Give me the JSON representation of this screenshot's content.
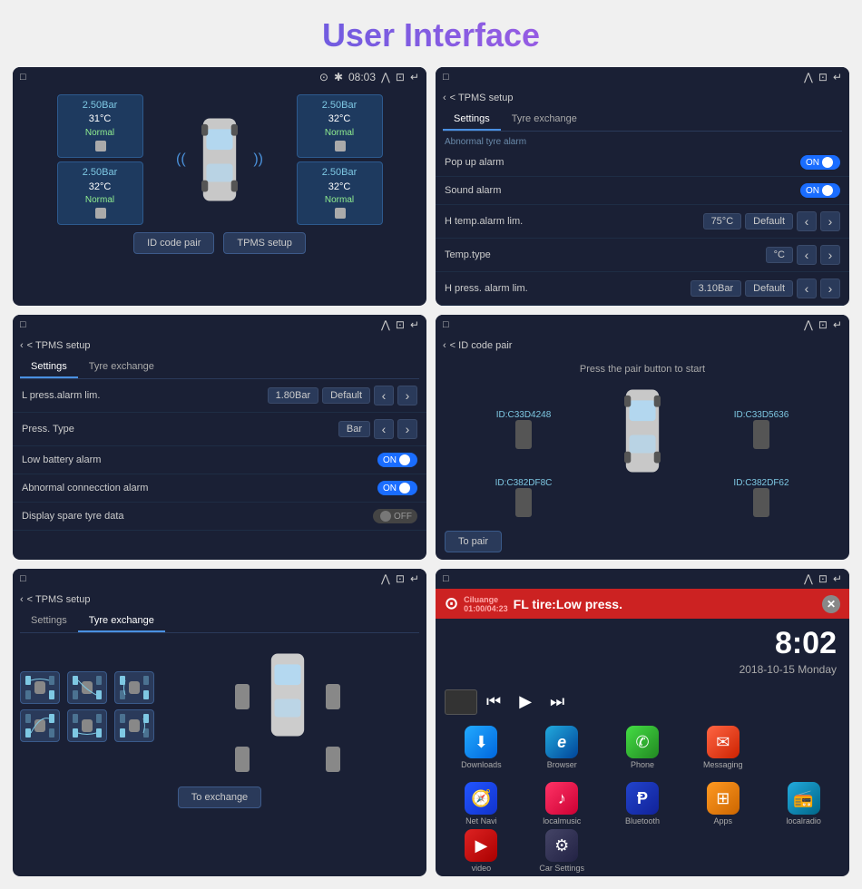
{
  "page": {
    "title": "User Interface",
    "background": "#f0f0f0"
  },
  "panels": {
    "p1": {
      "statusbar": {
        "left": [
          "□",
          "⊙",
          "✱",
          "08:03",
          "⋀"
        ],
        "right": [
          "⊡",
          "↵"
        ]
      },
      "tires": {
        "fl": {
          "bar": "2.50Bar",
          "temp": "31°C",
          "status": "Normal"
        },
        "fr": {
          "bar": "2.50Bar",
          "temp": "32°C",
          "status": "Normal"
        },
        "rl": {
          "bar": "2.50Bar",
          "temp": "32°C",
          "status": "Normal"
        },
        "rr": {
          "bar": "2.50Bar",
          "temp": "32°C",
          "status": "Normal"
        }
      },
      "buttons": [
        "ID code pair",
        "TPMS setup"
      ]
    },
    "p2": {
      "breadcrumb": "< TPMS setup",
      "tabs": [
        "Settings",
        "Tyre exchange"
      ],
      "active_tab": 0,
      "section_label": "Abnormal tyre alarm",
      "rows": [
        {
          "label": "Pop up alarm",
          "control": "toggle_on",
          "value": "ON"
        },
        {
          "label": "Sound alarm",
          "control": "toggle_on",
          "value": "ON"
        },
        {
          "label": "H temp.alarm lim.",
          "value1": "75°C",
          "value2": "Default",
          "control": "nav"
        },
        {
          "label": "Temp.type",
          "value1": "°C",
          "control": "nav"
        },
        {
          "label": "H press. alarm lim.",
          "value1": "3.10Bar",
          "value2": "Default",
          "control": "nav"
        }
      ]
    },
    "p3": {
      "breadcrumb": "< TPMS setup",
      "tabs": [
        "Settings",
        "Tyre exchange"
      ],
      "active_tab": 0,
      "rows": [
        {
          "label": "L press.alarm lim.",
          "value1": "1.80Bar",
          "value2": "Default",
          "control": "nav"
        },
        {
          "label": "Press. Type",
          "value1": "Bar",
          "control": "nav"
        },
        {
          "label": "Low battery alarm",
          "control": "toggle_on",
          "value": "ON"
        },
        {
          "label": "Abnormal connecction alarm",
          "control": "toggle_on",
          "value": "ON"
        },
        {
          "label": "Display spare tyre data",
          "control": "toggle_off",
          "value": "OFF"
        }
      ]
    },
    "p4": {
      "breadcrumb": "< ID code pair",
      "instruction": "Press the pair button to start",
      "ids": {
        "fl": "ID:C33D4248",
        "fr": "ID:C33D5636",
        "rl": "ID:C382DF8C",
        "rr": "ID:C382DF62"
      },
      "button": "To pair"
    },
    "p5": {
      "breadcrumb": "< TPMS setup",
      "tabs": [
        "Settings",
        "Tyre exchange"
      ],
      "active_tab": 1,
      "exchange_icons": [
        "swap-fl-fr",
        "swap-fl-rr",
        "swap-fl-rl",
        "swap-fr-rl",
        "swap-fr-rr",
        "swap-rl-rr"
      ],
      "button": "To exchange"
    },
    "p6": {
      "alert": {
        "tire_icon": "⚠",
        "source": "Ciluange",
        "time": "01:00/04:23",
        "message": "FL tire:Low press.",
        "separator": ":"
      },
      "clock": "8:02",
      "date": "2018-10-15  Monday",
      "media_controls": [
        "⏮",
        "▶",
        "⏭"
      ],
      "apps_row1": [
        {
          "label": "Downloads",
          "icon": "⬇",
          "class": "app-downloads"
        },
        {
          "label": "Browser",
          "icon": "e",
          "class": "app-browser"
        },
        {
          "label": "Phone",
          "icon": "✆",
          "class": "app-phone"
        },
        {
          "label": "Messaging",
          "icon": "✉",
          "class": "app-msg"
        }
      ],
      "apps_row2": [
        {
          "label": "Net Navi",
          "icon": "🧭",
          "class": "app-netnavi"
        },
        {
          "label": "localmusic",
          "icon": "♪",
          "class": "app-music"
        },
        {
          "label": "Bluetooth",
          "icon": "⚡",
          "class": "app-bluetooth"
        },
        {
          "label": "Apps",
          "icon": "⊞",
          "class": "app-apps"
        },
        {
          "label": "localradio",
          "icon": "📻",
          "class": "app-radio"
        },
        {
          "label": "video",
          "icon": "▶",
          "class": "app-video"
        },
        {
          "label": "Car Settings",
          "icon": "⚙",
          "class": "app-settings"
        }
      ]
    }
  }
}
